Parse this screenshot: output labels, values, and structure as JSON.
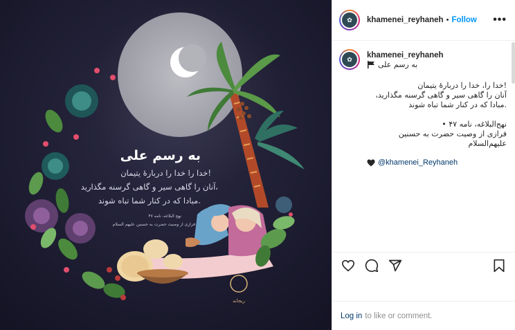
{
  "post": {
    "username": "khamenei_reyhaneh",
    "follow_label": "Follow",
    "more_label": "•••",
    "caption_flag_text": "به رسم علی",
    "caption_lines": [
      "!خدا را، خدا را دربارهٔ یتیمان",
      "آنان را گاهی سیر و گاهی گرسنه مگذارید،",
      ".مبادا که در کنار شما تباه شوند"
    ],
    "source_lines": [
      "نهج‌البلاغه، نامه ۴۷ •",
      "فرازی از وصیت حضرت به حسنین",
      "علیهم‌السلام"
    ],
    "mention": "@khamenei_Reyhaneh",
    "login_link": "Log in",
    "login_rest": "to like or comment."
  },
  "image": {
    "title": "به رسم علی",
    "line1": "خدا را خدا را دربارهٔ یتیمان!",
    "line2": "آنان را گاهی سیر و گاهی گرسنه مگذارید،",
    "line3": "مبادا که در کنار شما تباه شوند.",
    "source1": "نهج البلاغه، نامه ۴۷",
    "source2": "فرازی از وصیت حضرت به حسنین علیهم السلام",
    "logo_text": "ریحانه"
  },
  "icons": {
    "like": "heart-outline-icon",
    "comment": "comment-icon",
    "share": "share-icon",
    "save": "bookmark-icon"
  },
  "colors": {
    "follow": "#0095f6",
    "link": "#00376b",
    "background_art": "#1b1a2e"
  }
}
